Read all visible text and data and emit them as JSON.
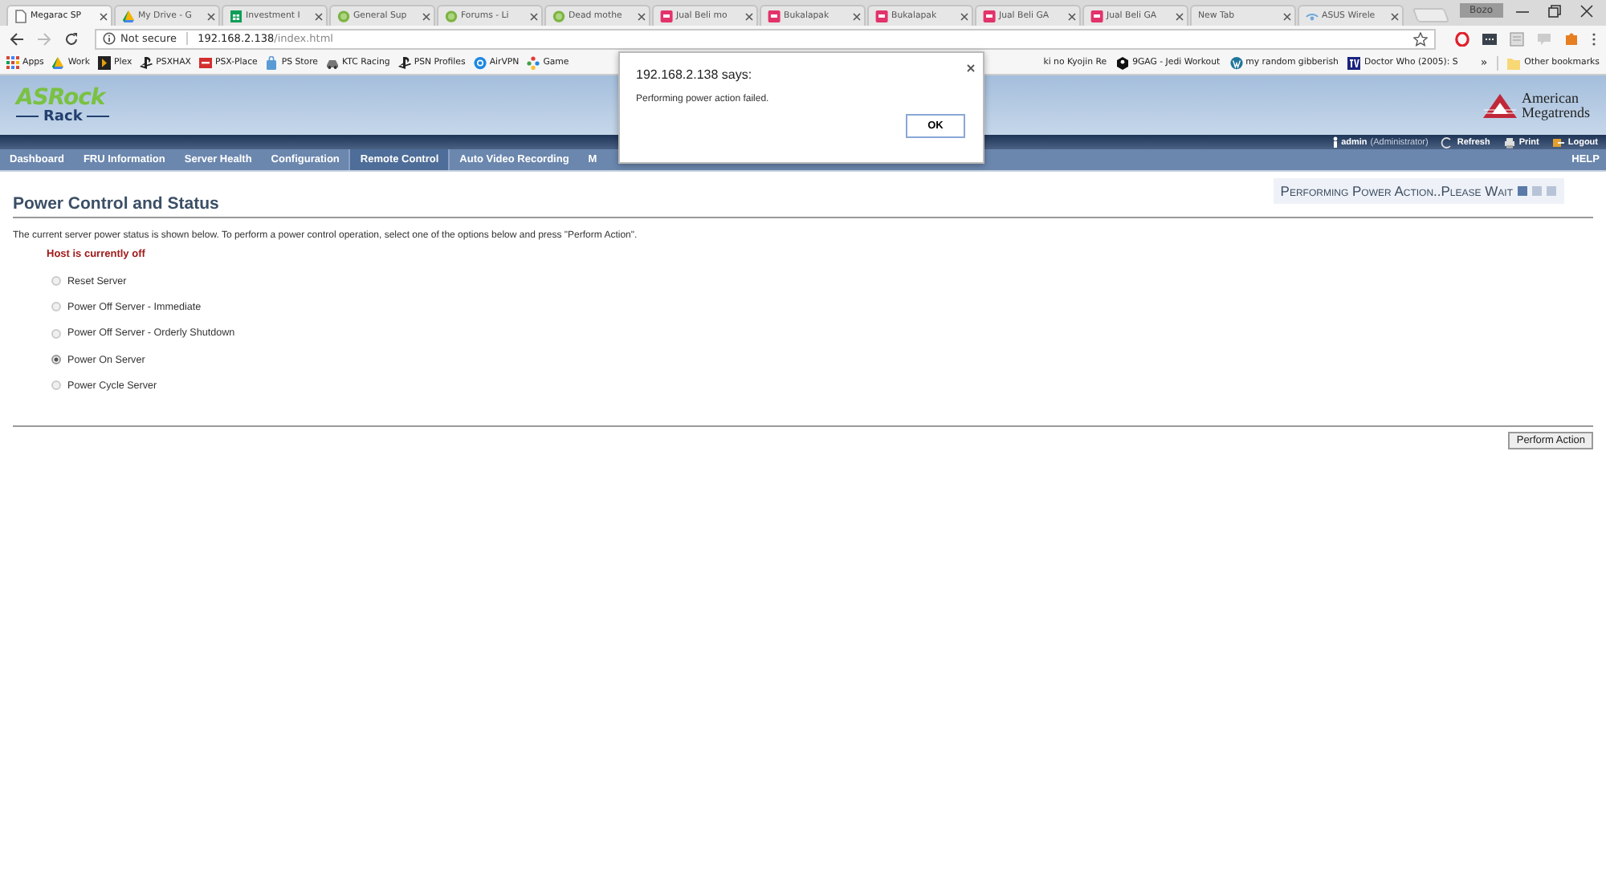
{
  "browser": {
    "tabs": [
      {
        "title": "Megarac SP",
        "kind": "page",
        "selected": true
      },
      {
        "title": "My Drive - G",
        "kind": "drive",
        "selected": false
      },
      {
        "title": "Investment I",
        "kind": "sheet",
        "selected": false
      },
      {
        "title": "General Sup",
        "kind": "forum",
        "selected": false
      },
      {
        "title": "Forums - Li",
        "kind": "forum",
        "selected": false
      },
      {
        "title": "Dead mothe",
        "kind": "forum",
        "selected": false
      },
      {
        "title": "Jual Beli mo",
        "kind": "shop",
        "selected": false
      },
      {
        "title": "Bukalapak",
        "kind": "shop",
        "selected": false
      },
      {
        "title": "Bukalapak",
        "kind": "shop",
        "selected": false
      },
      {
        "title": "Jual Beli GA",
        "kind": "shop",
        "selected": false
      },
      {
        "title": "Jual Beli GA",
        "kind": "shop",
        "selected": false
      },
      {
        "title": "New Tab",
        "kind": "none",
        "selected": false
      },
      {
        "title": "ASUS Wirele",
        "kind": "router",
        "selected": false
      }
    ],
    "profile": "Bozo",
    "address": {
      "security": "Not secure",
      "host": "192.168.2.138",
      "path": "/index.html"
    },
    "bookmarks": [
      {
        "label": "Apps",
        "kind": "grid"
      },
      {
        "label": "Work",
        "kind": "drive"
      },
      {
        "label": "Plex",
        "kind": "play"
      },
      {
        "label": "PSXHAX",
        "kind": "ps"
      },
      {
        "label": "PSX-Place",
        "kind": "red"
      },
      {
        "label": "PS Store",
        "kind": "bag"
      },
      {
        "label": "KTC Racing",
        "kind": "car"
      },
      {
        "label": "PSN Profiles",
        "kind": "ps"
      },
      {
        "label": "AirVPN",
        "kind": "globe"
      },
      {
        "label": "Game",
        "kind": "dots"
      }
    ],
    "bookmarks_right": [
      {
        "label": "ki no Kyojin Re",
        "kind": "none"
      },
      {
        "label": "9GAG - Jedi Workout",
        "kind": "nine"
      },
      {
        "label": "my random gibberish",
        "kind": "wp"
      },
      {
        "label": "Doctor Who (2005): S",
        "kind": "tv"
      }
    ],
    "overflow": "»",
    "other_bookmarks": "Other bookmarks"
  },
  "header": {
    "logo_top": "ASRock",
    "logo_bottom": "Rack",
    "vendor_line_1": "American",
    "vendor_line_2": "Megatrends",
    "user": "admin",
    "role": "(Administrator)",
    "links": [
      "Refresh",
      "Print",
      "Logout"
    ]
  },
  "nav": {
    "items": [
      {
        "label": "Dashboard",
        "selected": false
      },
      {
        "label": "FRU Information",
        "selected": false
      },
      {
        "label": "Server Health",
        "selected": false
      },
      {
        "label": "Configuration",
        "selected": false
      },
      {
        "label": "Remote Control",
        "selected": true
      },
      {
        "label": "Auto Video Recording",
        "selected": false
      },
      {
        "label": "M",
        "selected": false
      }
    ],
    "help": "HELP"
  },
  "content": {
    "title": "Power Control and Status",
    "status_message": "Performing Power Action..Please Wait",
    "description": "The current server power status is shown below. To perform a power control operation, select one of the options below and press \"Perform Action\".",
    "host_status": "Host is currently off",
    "options": [
      {
        "label": "Reset Server",
        "selected": false
      },
      {
        "label": "Power Off Server - Immediate",
        "selected": false
      },
      {
        "label": "Power Off Server - Orderly Shutdown",
        "selected": false
      },
      {
        "label": "Power On Server",
        "selected": true
      },
      {
        "label": "Power Cycle Server",
        "selected": false
      }
    ],
    "button": "Perform Action"
  },
  "dialog": {
    "title": "192.168.2.138 says:",
    "message": "Performing power action failed.",
    "button": "OK"
  }
}
